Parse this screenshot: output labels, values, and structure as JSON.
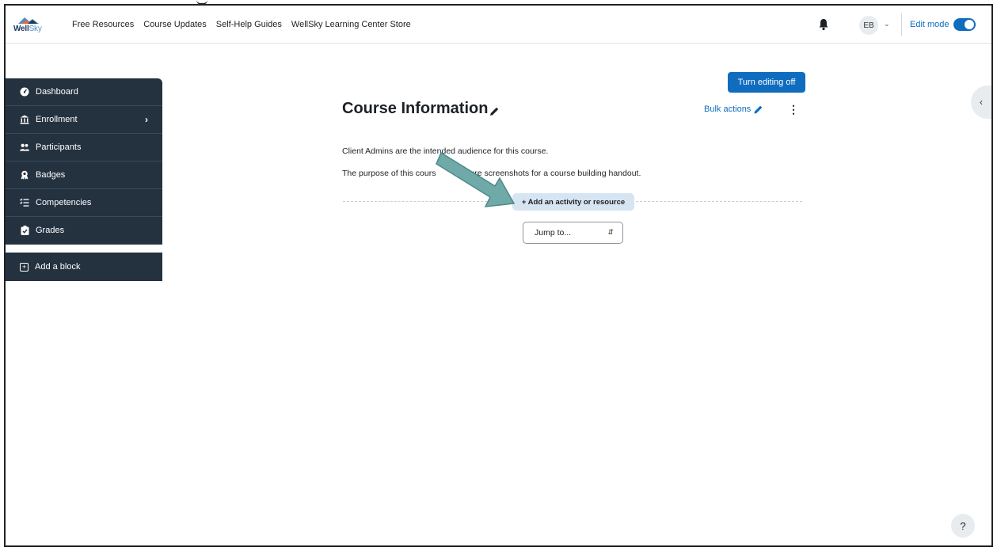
{
  "brand": {
    "name_main": "Well",
    "name_accent": "Sky"
  },
  "nav": {
    "links": [
      "Free Resources",
      "Course Updates",
      "Self-Help Guides",
      "WellSky Learning Center Store"
    ]
  },
  "user": {
    "initials": "EB"
  },
  "edit_mode": {
    "label": "Edit mode",
    "on": true
  },
  "drawer": {
    "items": [
      {
        "label": "Dashboard",
        "icon": "tachometer-icon"
      },
      {
        "label": "Enrollment",
        "icon": "bank-icon"
      },
      {
        "label": "Participants",
        "icon": "users-icon"
      },
      {
        "label": "Badges",
        "icon": "badge-icon"
      },
      {
        "label": "Competencies",
        "icon": "list-check-icon"
      },
      {
        "label": "Grades",
        "icon": "grades-icon"
      }
    ],
    "add_block": "Add a block"
  },
  "main": {
    "turn_editing": "Turn editing off",
    "title": "Course Information",
    "bulk_actions": "Bulk actions",
    "paragraph1": "Client Admins are the intended audience for this course.",
    "paragraph2_start": "The purpose of this cours",
    "paragraph2_end": "ture screenshots for a course building handout.",
    "add_activity": "+ Add an activity or resource",
    "jump_to": "Jump to..."
  },
  "help": "?",
  "colors": {
    "primary": "#0f6cbf",
    "drawer_bg": "#243240",
    "arrow": "#6fa9a8"
  }
}
